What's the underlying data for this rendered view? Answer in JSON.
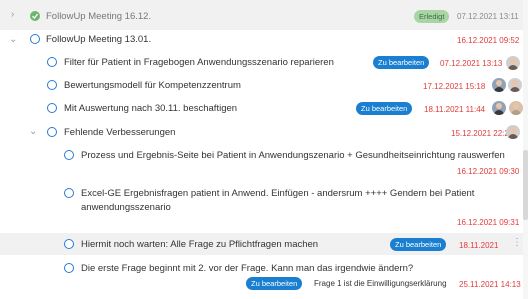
{
  "meetings": [
    {
      "title": "FollowUp Meeting 16.12.",
      "status": "Erledigt",
      "date": "07.12.2021 13:11"
    },
    {
      "title": "FollowUp Meeting 13.01.",
      "date": "16.12.2021 09:52"
    }
  ],
  "tasks": [
    {
      "title": "Filter für Patient in Fragebogen Anwendungsszenario reparieren",
      "badge": "Zu bearbeiten",
      "date": "07.12.2021 13:13"
    },
    {
      "title": "Bewertungsmodell für Kompetenzzentrum",
      "date": "17.12.2021 15:18"
    },
    {
      "title": "Mit Auswertung nach 30.11. beschaftigen",
      "badge": "Zu bearbeiten",
      "date": "18.11.2021 11:44"
    },
    {
      "title": "Fehlende Verbesserungen",
      "date": "15.12.2021 22:26"
    }
  ],
  "subtasks": [
    {
      "title": "Prozess und Ergebnis-Seite bei Patient in Anwendungszenario + Gesundheitseinrichtung rauswerfen",
      "date": "16.12.2021 09:30"
    },
    {
      "title_line1": "Excel-GE  Ergebnisfragen patient in Anwend. Einfügen - andersrum ++++ Gendern bei Patient",
      "title_line2": "anwendungsszenario",
      "date": "16.12.2021 09:31"
    },
    {
      "title": "Hiermit noch warten: Alle Frage zu Pflichtfragen machen",
      "badge": "Zu bearbeiten",
      "date": "18.11.2021"
    },
    {
      "title": "Die erste Frage beginnt mit 2. vor der Frage. Kann man das irgendwie ändern?",
      "badge": "Zu bearbeiten",
      "note": "Frage 1 ist die Einwilligungserklärung",
      "date": "25.11.2021 14:13"
    }
  ],
  "icons": {
    "collapsed": "chevron-right-icon",
    "expanded": "chevron-down-icon",
    "done": "check-circle-icon",
    "open": "circle-icon",
    "more": "more-vertical-icon"
  },
  "colors": {
    "accent": "#1a7fd1",
    "overdue": "#e23b3b",
    "done": "#6fb56f",
    "done_badge": "#a9d5a6"
  }
}
